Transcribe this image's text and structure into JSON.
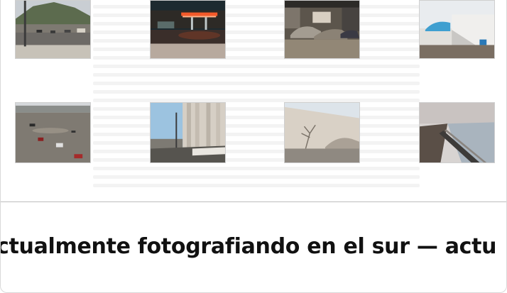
{
  "gallery": {
    "photos": [
      {
        "alt": "Valley road with hillside and parked cars"
      },
      {
        "alt": "Gas station canopy at night"
      },
      {
        "alt": "Garage interior with old cars"
      },
      {
        "alt": "White warehouse with blue awning"
      },
      {
        "alt": "Empty parking lot with scattered cars"
      },
      {
        "alt": "Grain elevators by a street"
      },
      {
        "alt": "Concrete wall with bare tree shadow"
      },
      {
        "alt": "Railway along a riverbank"
      }
    ]
  },
  "marquee": {
    "text": "ctualmente fotografiando en el sur — actu"
  },
  "colors": {
    "text": "#111111",
    "divider": "#bdbdbd",
    "background": "#ffffff"
  }
}
